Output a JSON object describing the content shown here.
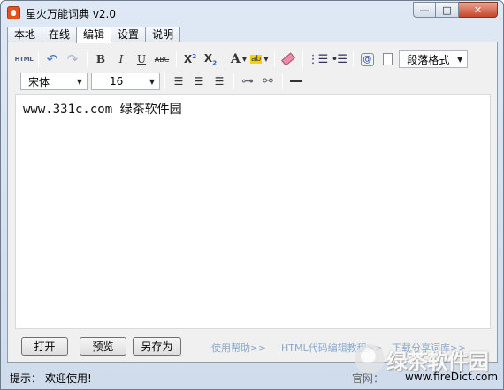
{
  "window": {
    "title": "星火万能词典 v2.0"
  },
  "tabs": [
    "本地",
    "在线",
    "编辑",
    "设置",
    "说明"
  ],
  "toolbar": {
    "html_label": "HTML",
    "undo": "↶",
    "redo": "↷",
    "bold": "B",
    "italic": "I",
    "underline": "U",
    "strike": "ABC",
    "font_color": "A",
    "highlight": "ab",
    "paragraph_format": "段落格式",
    "font_family": "宋体",
    "font_size": "16"
  },
  "editor": {
    "content": "www.331c.com 绿茶软件园"
  },
  "buttons": {
    "open": "打开",
    "preview": "预览",
    "save_as": "另存为"
  },
  "links": {
    "help": "使用帮助>>",
    "html_tutorial": "HTML代码编辑教程>>",
    "download_dict": "下载分享词库>>"
  },
  "status": {
    "label": "提示：",
    "message": "欢迎使用!",
    "site_label": "官网：",
    "site_url": "www.fireDict.com"
  },
  "watermark": {
    "text": "绿茶软件园"
  }
}
